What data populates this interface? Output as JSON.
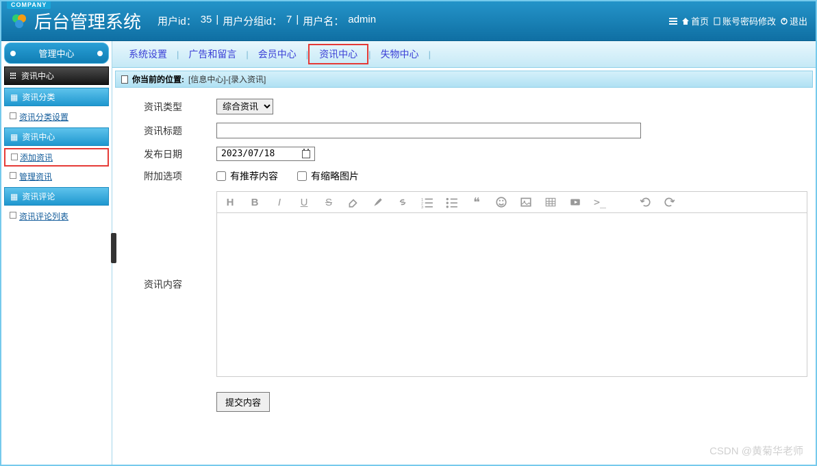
{
  "company_badge": "COMPANY",
  "app_title": "后台管理系统",
  "user_info": {
    "user_id_label": "用户id：",
    "user_id": "35",
    "group_id_label": "用户分组id：",
    "group_id": "7",
    "username_label": "用户名：",
    "username": "admin"
  },
  "top_links": {
    "home": "首页",
    "account": "账号密码修改",
    "logout": "退出"
  },
  "sidebar": {
    "header_tab": "管理中心",
    "main_section": "资讯中心",
    "groups": [
      {
        "title": "资讯分类",
        "items": [
          "资讯分类设置"
        ]
      },
      {
        "title": "资讯中心",
        "items": [
          "添加资讯",
          "管理资讯"
        ],
        "active_index": 0
      },
      {
        "title": "资讯评论",
        "items": [
          "资讯评论列表"
        ]
      }
    ]
  },
  "tabs": [
    "系统设置",
    "广告和留言",
    "会员中心",
    "资讯中心",
    "失物中心"
  ],
  "active_tab_index": 3,
  "breadcrumb": {
    "label": "你当前的位置:",
    "path": "[信息中心]-[录入资讯]"
  },
  "form": {
    "type_label": "资讯类型",
    "type_value": "综合资讯",
    "title_label": "资讯标题",
    "title_value": "",
    "date_label": "发布日期",
    "date_value": "2023/07/18",
    "options_label": "附加选项",
    "option_recommend": "有推荐内容",
    "option_thumbnail": "有缩略图片",
    "content_label": "资讯内容",
    "submit_label": "提交内容"
  },
  "editor_tools": [
    "H",
    "B",
    "I",
    "U",
    "S",
    "eraser",
    "brush",
    "link",
    "ol",
    "ul",
    "quote",
    "emoji",
    "image",
    "table",
    "video",
    "code",
    "undo",
    "redo"
  ],
  "watermark": "CSDN @黄菊华老师"
}
